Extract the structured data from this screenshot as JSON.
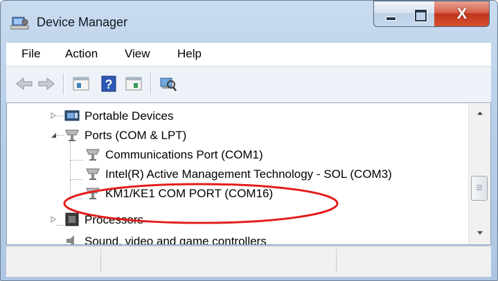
{
  "window": {
    "title": "Device Manager",
    "icon": "device-manager-icon",
    "title_icon": "computer-icon"
  },
  "title_controls": {
    "minimize_icon": "minimize-icon",
    "maximize_icon": "maximize-icon",
    "close_icon": "close-icon",
    "close_glyph": "X"
  },
  "menu": {
    "items": [
      {
        "label": "File"
      },
      {
        "label": "Action"
      },
      {
        "label": "View"
      },
      {
        "label": "Help"
      }
    ]
  },
  "toolbar": {
    "buttons": [
      "back-icon",
      "forward-icon",
      "properties-icon",
      "help-icon",
      "view-pane-icon",
      "scan-hardware-icon"
    ]
  },
  "tree": {
    "nodes": [
      {
        "label": "Portable Devices",
        "icon": "portable-devices-icon",
        "expanded": false
      },
      {
        "label": "Ports (COM & LPT)",
        "icon": "port-icon",
        "expanded": true,
        "children": [
          {
            "label": "Communications Port (COM1)",
            "icon": "port-icon"
          },
          {
            "label": "Intel(R) Active Management Technology - SOL (COM3)",
            "icon": "port-icon"
          },
          {
            "label": "KM1/KE1 COM PORT (COM16)",
            "icon": "port-icon",
            "highlighted": true
          }
        ]
      },
      {
        "label": "Processors",
        "icon": "processor-icon",
        "expanded": false
      },
      {
        "label": "Sound, video and game controllers",
        "icon": "sound-icon",
        "expanded": false,
        "partially_visible": true
      }
    ]
  },
  "annotation": {
    "shape": "ellipse",
    "color": "#e41b1b",
    "target": "KM1/KE1 COM PORT (COM16)"
  },
  "colors": {
    "title_bar": "#b9cfe8",
    "close_button": "#c7432b",
    "annotation_red": "#e41b1b"
  }
}
